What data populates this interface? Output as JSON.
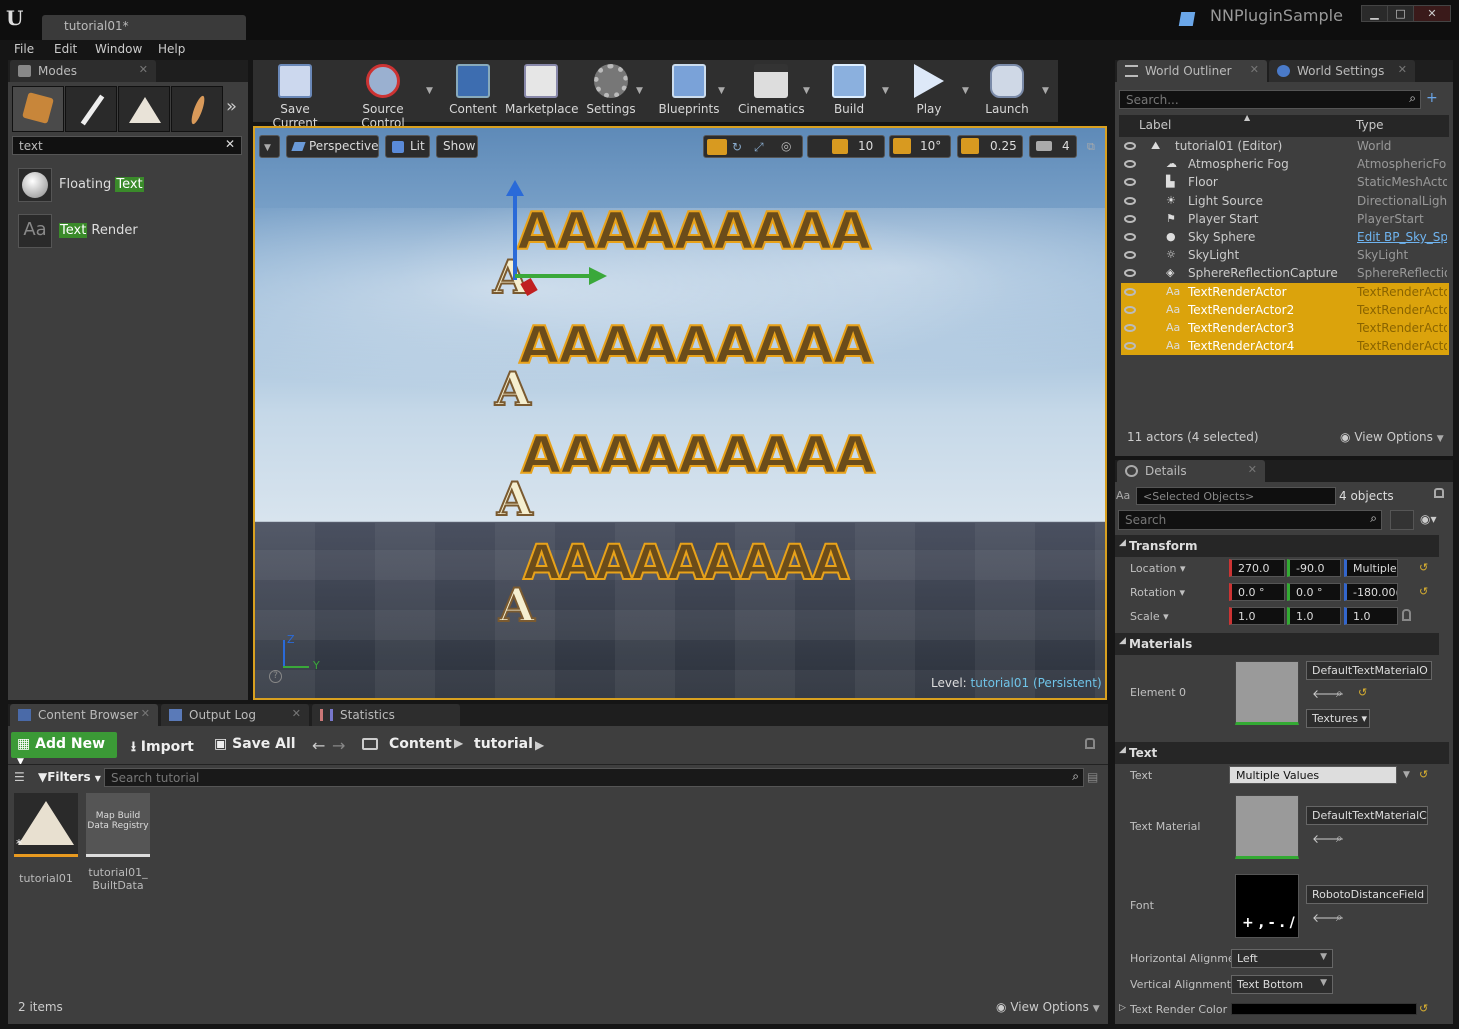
{
  "window": {
    "doc_tab": "tutorial01*",
    "project": "NNPluginSample",
    "min": "▁",
    "max": "□",
    "close": "✕"
  },
  "menu": [
    "File",
    "Edit",
    "Window",
    "Help"
  ],
  "modes": {
    "tab_label": "Modes",
    "search_value": "text",
    "results": [
      {
        "pre": "Floating ",
        "match": "Text",
        "post": ""
      },
      {
        "pre": "",
        "match": "Text",
        "post": " Render"
      }
    ]
  },
  "toolbar": {
    "buttons": [
      "Save Current",
      "Source Control",
      "Content",
      "Marketplace",
      "Settings",
      "Blueprints",
      "Cinematics",
      "Build",
      "Play",
      "Launch"
    ]
  },
  "viewport": {
    "perspective": "Perspective",
    "lit": "Lit",
    "show": "Show",
    "grid_snap": "10",
    "rot_snap": "10°",
    "scale_snap": "0.25",
    "cam_speed": "4",
    "level_label": "Level:",
    "level_name": "tutorial01 (Persistent)",
    "text_row": "AAAAAAAAA",
    "text_front": "A",
    "axis_y": "Y",
    "axis_z": "Z"
  },
  "outliner": {
    "tab_label": "World Outliner",
    "settings_tab": "World Settings",
    "search_placeholder": "Search...",
    "col_label": "Label",
    "col_type": "Type",
    "rows": [
      {
        "label": "tutorial01 (Editor)",
        "type": "World",
        "icon": "world-icon"
      },
      {
        "label": "Atmospheric Fog",
        "type": "AtmosphericFog",
        "icon": "fog-icon"
      },
      {
        "label": "Floor",
        "type": "StaticMeshActor",
        "icon": "mesh-icon"
      },
      {
        "label": "Light Source",
        "type": "DirectionalLight",
        "icon": "light-icon"
      },
      {
        "label": "Player Start",
        "type": "PlayerStart",
        "icon": "flag-icon"
      },
      {
        "label": "Sky Sphere",
        "type": "Edit BP_Sky_Sp",
        "icon": "sphere-icon"
      },
      {
        "label": "SkyLight",
        "type": "SkyLight",
        "icon": "skylight-icon"
      },
      {
        "label": "SphereReflectionCapture",
        "type": "SphereReflection",
        "icon": "reflection-icon"
      },
      {
        "label": "TextRenderActor",
        "type": "TextRenderActor",
        "icon": "text-render-icon"
      },
      {
        "label": "TextRenderActor2",
        "type": "TextRenderActor",
        "icon": "text-render-icon"
      },
      {
        "label": "TextRenderActor3",
        "type": "TextRenderActor",
        "icon": "text-render-icon"
      },
      {
        "label": "TextRenderActor4",
        "type": "TextRenderActor",
        "icon": "text-render-icon"
      }
    ],
    "status": "11 actors (4 selected)",
    "view_options": "View Options"
  },
  "details": {
    "tab_label": "Details",
    "selected_placeholder": "<Selected Objects>",
    "count": "4 objects",
    "search_placeholder": "Search",
    "transform": "Transform",
    "location_label": "Location",
    "location": [
      "270.0",
      "-90.0",
      "Multiple V"
    ],
    "rotation_label": "Rotation",
    "rotation": [
      "0.0 °",
      "0.0 °",
      "-180.00("
    ],
    "scale_label": "Scale",
    "scale": [
      "1.0",
      "1.0",
      "1.0"
    ],
    "materials": "Materials",
    "element0": "Element 0",
    "mat_name": "DefaultTextMaterialO",
    "textures": "Textures",
    "text_section": "Text",
    "text_label": "Text",
    "text_value": "Multiple Values",
    "text_material_label": "Text Material",
    "text_material": "DefaultTextMaterialC",
    "font_label": "Font",
    "font_value": "RobotoDistanceField",
    "halign_label": "Horizontal Alignme",
    "halign": "Left",
    "valign_label": "Vertical Alignment",
    "valign": "Text Bottom",
    "color_label": "Text Render Color"
  },
  "bottom": {
    "tabs": [
      "Content Browser",
      "Output Log",
      "Statistics"
    ],
    "add_new": "Add New",
    "import": "Import",
    "save_all": "Save All",
    "crumbs": [
      "Content",
      "tutorial"
    ],
    "filters": "Filters",
    "search_placeholder": "Search tutorial",
    "assets": [
      {
        "name": "tutorial01",
        "thumb": ""
      },
      {
        "name": "tutorial01_\nBuiltData",
        "thumb": "Map Build\nData Registry"
      }
    ],
    "count": "2 items",
    "view_options": "View Options"
  }
}
